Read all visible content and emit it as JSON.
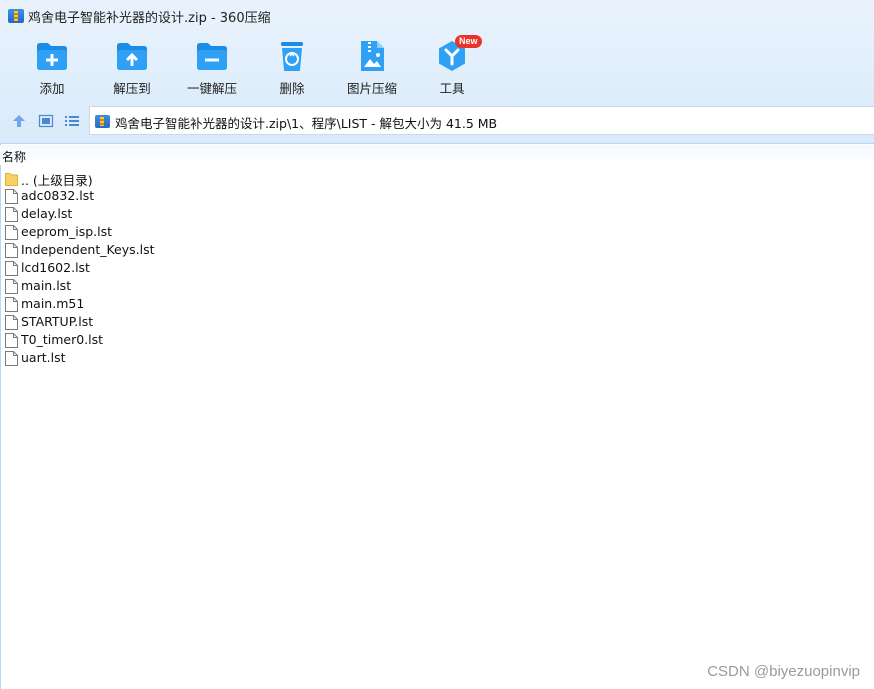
{
  "window": {
    "title": "鸡舍电子智能补光器的设计.zip - 360压缩",
    "app_icon": "archive-icon"
  },
  "toolbar": {
    "items": [
      {
        "label": "添加",
        "icon": "folder-add-icon"
      },
      {
        "label": "解压到",
        "icon": "folder-extract-icon"
      },
      {
        "label": "一键解压",
        "icon": "folder-oneclick-icon"
      },
      {
        "label": "删除",
        "icon": "trash-icon"
      },
      {
        "label": "图片压缩",
        "icon": "image-compress-icon"
      },
      {
        "label": "工具",
        "icon": "tools-icon",
        "badge": "New"
      }
    ]
  },
  "navbar": {
    "buttons": [
      {
        "icon": "up-arrow-icon"
      },
      {
        "icon": "thumbnail-view-icon"
      },
      {
        "icon": "list-view-icon"
      }
    ],
    "path": "鸡舍电子智能补光器的设计.zip\\1、程序\\LIST - 解包大小为 41.5 MB"
  },
  "list": {
    "column_header": "名称",
    "files": [
      {
        "name": ".. (上级目录)",
        "type": "folder"
      },
      {
        "name": "adc0832.lst",
        "type": "file"
      },
      {
        "name": "delay.lst",
        "type": "file"
      },
      {
        "name": "eeprom_isp.lst",
        "type": "file"
      },
      {
        "name": "Independent_Keys.lst",
        "type": "file"
      },
      {
        "name": "lcd1602.lst",
        "type": "file"
      },
      {
        "name": "main.lst",
        "type": "file"
      },
      {
        "name": "main.m51",
        "type": "file"
      },
      {
        "name": "STARTUP.lst",
        "type": "file"
      },
      {
        "name": "T0_timer0.lst",
        "type": "file"
      },
      {
        "name": "uart.lst",
        "type": "file"
      }
    ]
  },
  "watermark": "CSDN @biyezuopinvip",
  "colors": {
    "accent": "#1e88e5",
    "toolbar_bg": "#e3effc",
    "badge": "#e8342a",
    "folder": "#f7cf63"
  }
}
